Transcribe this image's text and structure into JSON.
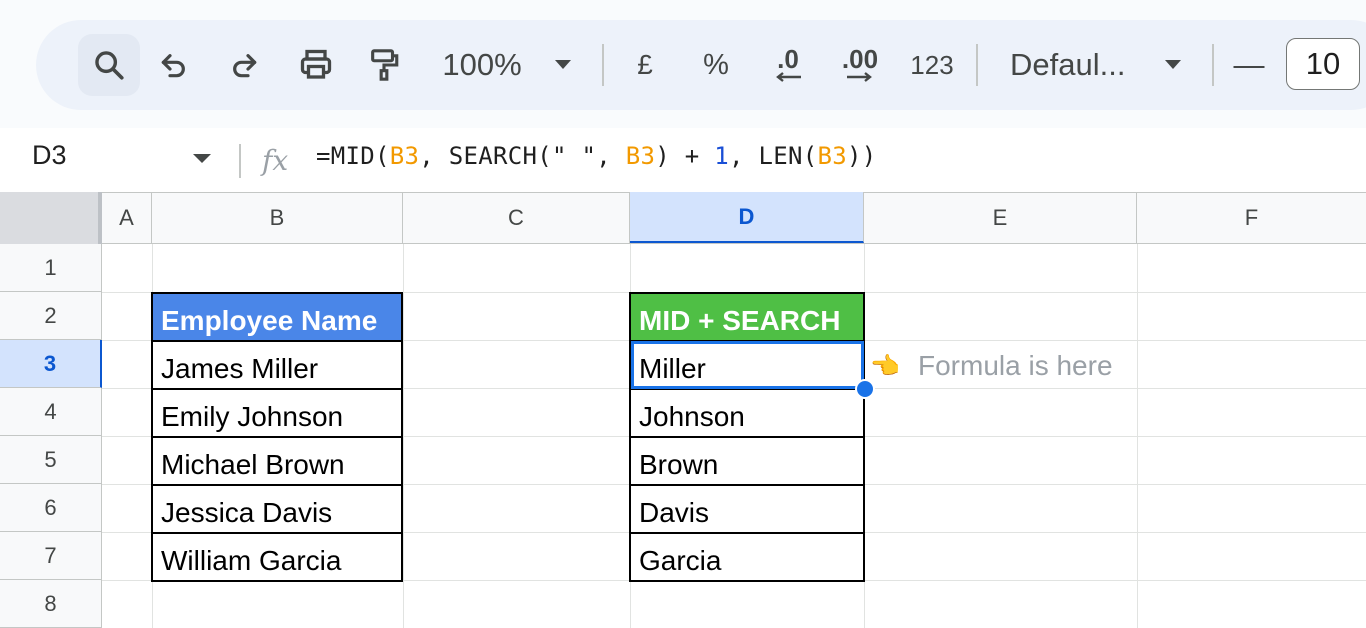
{
  "toolbar": {
    "zoom": "100%",
    "currency": "£",
    "percent": "%",
    "decrease_decimal": ".0",
    "increase_decimal": ".00",
    "number_format": "123",
    "font": "Defaul...",
    "font_size": "10",
    "decrease_size": "—"
  },
  "formula_bar": {
    "name_box": "D3",
    "formula_parts": [
      {
        "text": "=MID(",
        "kind": "plain"
      },
      {
        "text": "B3",
        "kind": "ref"
      },
      {
        "text": ", SEARCH(\" \", ",
        "kind": "plain"
      },
      {
        "text": "B3",
        "kind": "ref"
      },
      {
        "text": ") + ",
        "kind": "plain"
      },
      {
        "text": "1",
        "kind": "num"
      },
      {
        "text": ", LEN(",
        "kind": "plain"
      },
      {
        "text": "B3",
        "kind": "ref"
      },
      {
        "text": "))",
        "kind": "plain"
      }
    ]
  },
  "columns": [
    "A",
    "B",
    "C",
    "D",
    "E",
    "F"
  ],
  "rows": [
    "1",
    "2",
    "3",
    "4",
    "5",
    "6",
    "7",
    "8"
  ],
  "selected_column": "D",
  "selected_row": "3",
  "table_left": {
    "header": "Employee Name",
    "values": [
      "James Miller",
      "Emily Johnson",
      "Michael Brown",
      "Jessica Davis",
      "William Garcia"
    ]
  },
  "table_right": {
    "header": "MID + SEARCH",
    "values": [
      "Miller",
      "Johnson",
      "Brown",
      "Davis",
      "Garcia"
    ]
  },
  "annotation": {
    "pointer_emoji": "👈",
    "text": "Formula is here"
  },
  "colors": {
    "header_blue": "#4a86e8",
    "header_green": "#4fbf45",
    "selection": "#1a73e8"
  }
}
